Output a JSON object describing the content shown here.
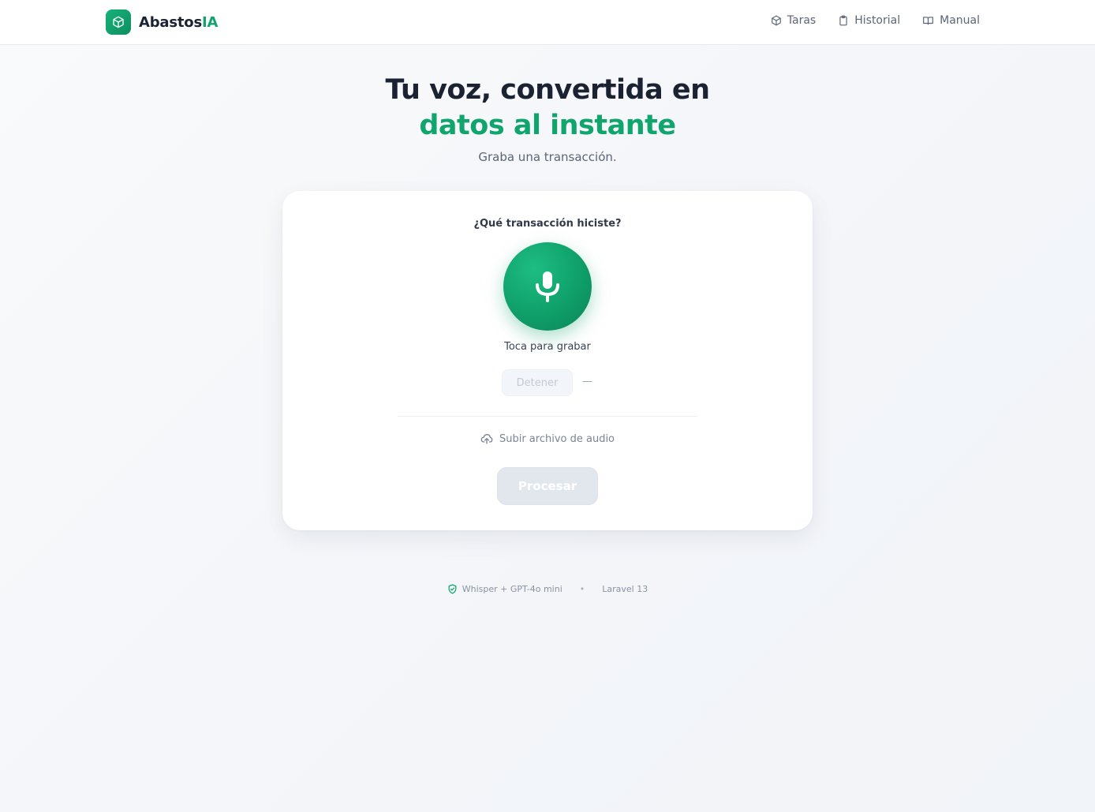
{
  "header": {
    "brand_primary": "Abastos",
    "brand_accent": "IA",
    "nav": [
      {
        "label": "Taras",
        "icon": "cube-icon"
      },
      {
        "label": "Historial",
        "icon": "clipboard-icon"
      },
      {
        "label": "Manual",
        "icon": "book-icon"
      }
    ]
  },
  "hero": {
    "title_line1": "Tu voz, convertida en",
    "title_line2": "datos al instante",
    "subtitle": "Graba una transacción."
  },
  "recorder": {
    "question": "¿Qué transacción hiciste?",
    "mic_icon": "microphone-icon",
    "tap_label": "Toca para grabar",
    "stop_label": "Detener",
    "timer": "—",
    "upload_label": "Subir archivo de audio",
    "process_label": "Procesar"
  },
  "footer": {
    "engine": "Whisper + GPT-4o mini",
    "separator": "•",
    "framework": "Laravel 13"
  },
  "colors": {
    "accent": "#10a36b",
    "text_dark": "#1b2333",
    "muted": "#5c6575",
    "disabled": "#e2e7ee"
  }
}
